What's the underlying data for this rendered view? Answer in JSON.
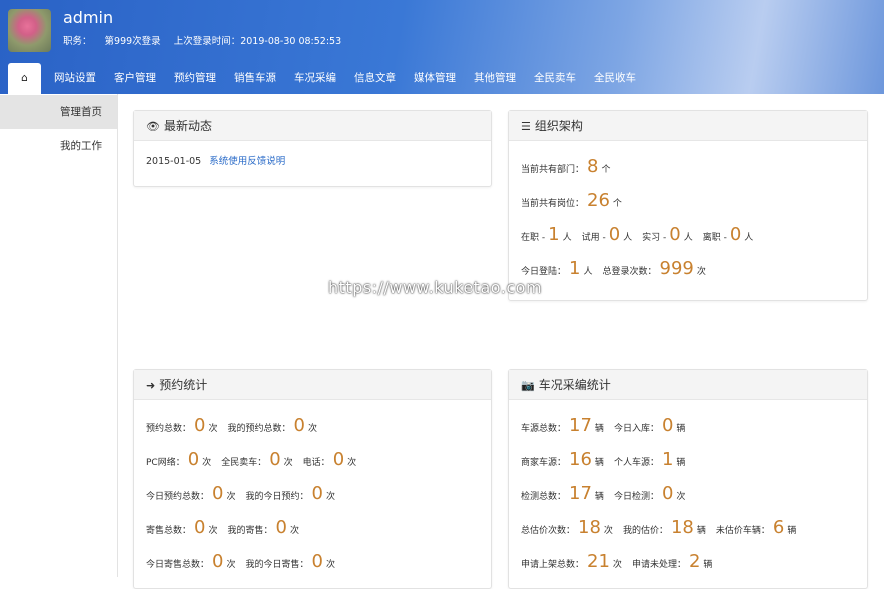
{
  "user": {
    "name": "admin",
    "role_label": "职务：",
    "login_count": "第999次登录",
    "last_login": "上次登录时间：2019-08-30 08:52:53"
  },
  "nav": {
    "home_icon": "home-icon",
    "tabs": [
      "网站设置",
      "客户管理",
      "预约管理",
      "销售车源",
      "车况采编",
      "信息文章",
      "媒体管理",
      "其他管理",
      "全民卖车",
      "全民收车"
    ]
  },
  "sidebar": {
    "items": [
      "管理首页",
      "我的工作"
    ]
  },
  "colors": {
    "accent_number": "#c8812f",
    "link": "#2a6bc8",
    "header": "#3a78d6"
  },
  "news": {
    "title": "最新动态",
    "icon": "eye-icon",
    "date": "2015-01-05",
    "link": "系统使用反馈说明"
  },
  "org": {
    "title": "组织架构",
    "icon": "list-icon",
    "rows": [
      [
        {
          "label": "当前共有部门：",
          "value": "8",
          "unit": "个"
        }
      ],
      [
        {
          "label": "当前共有岗位：",
          "value": "26",
          "unit": "个"
        }
      ],
      [
        {
          "label": "在职 - ",
          "value": "1",
          "unit": "人"
        },
        {
          "label": "试用 - ",
          "value": "0",
          "unit": "人"
        },
        {
          "label": "实习 - ",
          "value": "0",
          "unit": "人"
        },
        {
          "label": "离职 - ",
          "value": "0",
          "unit": "人"
        }
      ],
      [
        {
          "label": "今日登陆：",
          "value": "1",
          "unit": "人"
        },
        {
          "label": "总登录次数：",
          "value": "999",
          "unit": "次"
        }
      ]
    ]
  },
  "booking": {
    "title": "预约统计",
    "icon": "sign-in-icon",
    "rows": [
      [
        {
          "label": "预约总数：",
          "value": "0",
          "unit": "次"
        },
        {
          "label": "我的预约总数：",
          "value": "0",
          "unit": "次"
        }
      ],
      [
        {
          "label": "PC网络：",
          "value": "0",
          "unit": "次"
        },
        {
          "label": "全民卖车：",
          "value": "0",
          "unit": "次"
        },
        {
          "label": "电话：",
          "value": "0",
          "unit": "次"
        }
      ],
      [
        {
          "label": "今日预约总数：",
          "value": "0",
          "unit": "次"
        },
        {
          "label": "我的今日预约：",
          "value": "0",
          "unit": "次"
        }
      ],
      [
        {
          "label": "寄售总数：",
          "value": "0",
          "unit": "次"
        },
        {
          "label": "我的寄售：",
          "value": "0",
          "unit": "次"
        }
      ],
      [
        {
          "label": "今日寄售总数：",
          "value": "0",
          "unit": "次"
        },
        {
          "label": "我的今日寄售：",
          "value": "0",
          "unit": "次"
        }
      ]
    ]
  },
  "cars": {
    "title": "车况采编统计",
    "icon": "camera-icon",
    "rows": [
      [
        {
          "label": "车源总数：",
          "value": "17",
          "unit": "辆"
        },
        {
          "label": "今日入库：",
          "value": "0",
          "unit": "辆"
        }
      ],
      [
        {
          "label": "商家车源：",
          "value": "16",
          "unit": "辆"
        },
        {
          "label": "个人车源：",
          "value": "1",
          "unit": "辆"
        }
      ],
      [
        {
          "label": "检测总数：",
          "value": "17",
          "unit": "辆"
        },
        {
          "label": "今日检测：",
          "value": "0",
          "unit": "次"
        }
      ],
      [
        {
          "label": "总估价次数：",
          "value": "18",
          "unit": "次"
        },
        {
          "label": "我的估价：",
          "value": "18",
          "unit": "辆"
        },
        {
          "label": "未估价车辆：",
          "value": "6",
          "unit": "辆"
        }
      ],
      [
        {
          "label": "申请上架总数：",
          "value": "21",
          "unit": "次"
        },
        {
          "label": "申请未处理：",
          "value": "2",
          "unit": "辆"
        }
      ]
    ]
  },
  "watermark": "https://www.kuketao.com"
}
